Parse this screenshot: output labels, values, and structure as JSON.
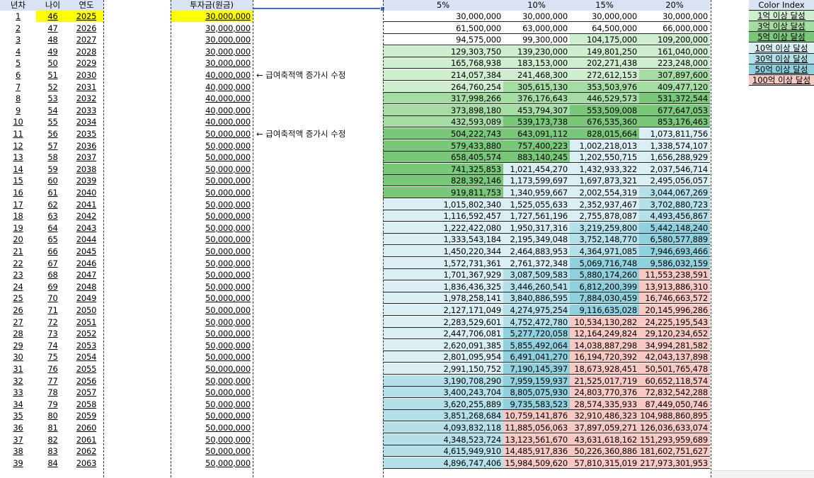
{
  "headers": {
    "year_no": "년차",
    "age": "나이",
    "year": "연도",
    "invest": "투자금(원금)",
    "r5": "5%",
    "r10": "10%",
    "r15": "15%",
    "r20": "20%"
  },
  "notes": [
    {
      "row": 6,
      "text": "← 급여축적액 증가시 수정"
    },
    {
      "row": 11,
      "text": "← 급여축적액 증가시 수정"
    }
  ],
  "legend": {
    "title": "Color Index",
    "items": [
      {
        "label": "1억 이상 달성",
        "color": "#cfeecf"
      },
      {
        "label": "3억 이상 달성",
        "color": "#a4dca4"
      },
      {
        "label": "5억 이상 달성",
        "color": "#79c779"
      },
      {
        "label": "10억 이상 달성",
        "color": "#daeff3"
      },
      {
        "label": "30억 이상 달성",
        "color": "#b3e0e9"
      },
      {
        "label": "50억 이상 달성",
        "color": "#8fd0de"
      },
      {
        "label": "100억 이상 달성",
        "color": "#f7c9c2"
      }
    ]
  },
  "highlight_color": "#ffff00",
  "rows": [
    {
      "n": "1",
      "age": "46",
      "year": "2025",
      "invest": "30,000,000",
      "v5": "30,000,000",
      "v10": "30,000,000",
      "v15": "30,000,000",
      "v20": "30,000,000",
      "c5": "",
      "c10": "",
      "c15": "",
      "c20": ""
    },
    {
      "n": "2",
      "age": "47",
      "year": "2026",
      "invest": "30,000,000",
      "v5": "61,500,000",
      "v10": "63,000,000",
      "v15": "64,500,000",
      "v20": "66,000,000",
      "c5": "",
      "c10": "",
      "c15": "",
      "c20": ""
    },
    {
      "n": "3",
      "age": "48",
      "year": "2027",
      "invest": "30,000,000",
      "v5": "94,575,000",
      "v10": "99,300,000",
      "v15": "104,175,000",
      "v20": "109,200,000",
      "c5": "",
      "c10": "",
      "c15": "#cfeecf",
      "c20": "#cfeecf"
    },
    {
      "n": "4",
      "age": "49",
      "year": "2028",
      "invest": "30,000,000",
      "v5": "129,303,750",
      "v10": "139,230,000",
      "v15": "149,801,250",
      "v20": "161,040,000",
      "c5": "#cfeecf",
      "c10": "#cfeecf",
      "c15": "#cfeecf",
      "c20": "#cfeecf"
    },
    {
      "n": "5",
      "age": "50",
      "year": "2029",
      "invest": "30,000,000",
      "v5": "165,768,938",
      "v10": "183,153,000",
      "v15": "202,271,438",
      "v20": "223,248,000",
      "c5": "#cfeecf",
      "c10": "#cfeecf",
      "c15": "#cfeecf",
      "c20": "#cfeecf"
    },
    {
      "n": "6",
      "age": "51",
      "year": "2030",
      "invest": "40,000,000",
      "v5": "214,057,384",
      "v10": "241,468,300",
      "v15": "272,612,153",
      "v20": "307,897,600",
      "c5": "#cfeecf",
      "c10": "#cfeecf",
      "c15": "#cfeecf",
      "c20": "#a4dca4"
    },
    {
      "n": "7",
      "age": "52",
      "year": "2031",
      "invest": "40,000,000",
      "v5": "264,760,254",
      "v10": "305,615,130",
      "v15": "353,503,976",
      "v20": "409,477,120",
      "c5": "#cfeecf",
      "c10": "#a4dca4",
      "c15": "#a4dca4",
      "c20": "#a4dca4"
    },
    {
      "n": "8",
      "age": "53",
      "year": "2032",
      "invest": "40,000,000",
      "v5": "317,998,266",
      "v10": "376,176,643",
      "v15": "446,529,573",
      "v20": "531,372,544",
      "c5": "#a4dca4",
      "c10": "#a4dca4",
      "c15": "#a4dca4",
      "c20": "#79c779"
    },
    {
      "n": "9",
      "age": "54",
      "year": "2033",
      "invest": "40,000,000",
      "v5": "373,898,180",
      "v10": "453,794,307",
      "v15": "553,509,008",
      "v20": "677,647,053",
      "c5": "#a4dca4",
      "c10": "#a4dca4",
      "c15": "#79c779",
      "c20": "#79c779"
    },
    {
      "n": "10",
      "age": "55",
      "year": "2034",
      "invest": "40,000,000",
      "v5": "432,593,089",
      "v10": "539,173,738",
      "v15": "676,535,360",
      "v20": "853,176,463",
      "c5": "#a4dca4",
      "c10": "#79c779",
      "c15": "#79c779",
      "c20": "#79c779"
    },
    {
      "n": "11",
      "age": "56",
      "year": "2035",
      "invest": "50,000,000",
      "v5": "504,222,743",
      "v10": "643,091,112",
      "v15": "828,015,664",
      "v20": "1,073,811,756",
      "c5": "#79c779",
      "c10": "#79c779",
      "c15": "#79c779",
      "c20": "#daeff3"
    },
    {
      "n": "12",
      "age": "57",
      "year": "2036",
      "invest": "50,000,000",
      "v5": "579,433,880",
      "v10": "757,400,223",
      "v15": "1,002,218,013",
      "v20": "1,338,574,107",
      "c5": "#79c779",
      "c10": "#79c779",
      "c15": "#daeff3",
      "c20": "#daeff3"
    },
    {
      "n": "13",
      "age": "58",
      "year": "2037",
      "invest": "50,000,000",
      "v5": "658,405,574",
      "v10": "883,140,245",
      "v15": "1,202,550,715",
      "v20": "1,656,288,929",
      "c5": "#79c779",
      "c10": "#79c779",
      "c15": "#daeff3",
      "c20": "#daeff3"
    },
    {
      "n": "14",
      "age": "59",
      "year": "2038",
      "invest": "50,000,000",
      "v5": "741,325,853",
      "v10": "1,021,454,270",
      "v15": "1,432,933,322",
      "v20": "2,037,546,714",
      "c5": "#79c779",
      "c10": "#daeff3",
      "c15": "#daeff3",
      "c20": "#daeff3"
    },
    {
      "n": "15",
      "age": "60",
      "year": "2039",
      "invest": "50,000,000",
      "v5": "828,392,146",
      "v10": "1,173,599,697",
      "v15": "1,697,873,321",
      "v20": "2,495,056,057",
      "c5": "#79c779",
      "c10": "#daeff3",
      "c15": "#daeff3",
      "c20": "#daeff3"
    },
    {
      "n": "16",
      "age": "61",
      "year": "2040",
      "invest": "50,000,000",
      "v5": "919,811,753",
      "v10": "1,340,959,667",
      "v15": "2,002,554,319",
      "v20": "3,044,067,269",
      "c5": "#79c779",
      "c10": "#daeff3",
      "c15": "#daeff3",
      "c20": "#b3e0e9"
    },
    {
      "n": "17",
      "age": "62",
      "year": "2041",
      "invest": "50,000,000",
      "v5": "1,015,802,340",
      "v10": "1,525,055,633",
      "v15": "2,352,937,467",
      "v20": "3,702,880,723",
      "c5": "#daeff3",
      "c10": "#daeff3",
      "c15": "#daeff3",
      "c20": "#b3e0e9"
    },
    {
      "n": "18",
      "age": "63",
      "year": "2042",
      "invest": "50,000,000",
      "v5": "1,116,592,457",
      "v10": "1,727,561,196",
      "v15": "2,755,878,087",
      "v20": "4,493,456,867",
      "c5": "#daeff3",
      "c10": "#daeff3",
      "c15": "#daeff3",
      "c20": "#b3e0e9"
    },
    {
      "n": "19",
      "age": "64",
      "year": "2043",
      "invest": "50,000,000",
      "v5": "1,222,422,080",
      "v10": "1,950,317,316",
      "v15": "3,219,259,800",
      "v20": "5,442,148,240",
      "c5": "#daeff3",
      "c10": "#daeff3",
      "c15": "#b3e0e9",
      "c20": "#8fd0de"
    },
    {
      "n": "20",
      "age": "65",
      "year": "2044",
      "invest": "50,000,000",
      "v5": "1,333,543,184",
      "v10": "2,195,349,048",
      "v15": "3,752,148,770",
      "v20": "6,580,577,889",
      "c5": "#daeff3",
      "c10": "#daeff3",
      "c15": "#b3e0e9",
      "c20": "#8fd0de"
    },
    {
      "n": "21",
      "age": "66",
      "year": "2045",
      "invest": "50,000,000",
      "v5": "1,450,220,344",
      "v10": "2,464,883,953",
      "v15": "4,364,971,085",
      "v20": "7,946,693,466",
      "c5": "#daeff3",
      "c10": "#daeff3",
      "c15": "#b3e0e9",
      "c20": "#8fd0de"
    },
    {
      "n": "22",
      "age": "67",
      "year": "2046",
      "invest": "50,000,000",
      "v5": "1,572,731,361",
      "v10": "2,761,372,348",
      "v15": "5,069,716,748",
      "v20": "9,586,032,159",
      "c5": "#daeff3",
      "c10": "#daeff3",
      "c15": "#8fd0de",
      "c20": "#8fd0de"
    },
    {
      "n": "23",
      "age": "68",
      "year": "2047",
      "invest": "50,000,000",
      "v5": "1,701,367,929",
      "v10": "3,087,509,583",
      "v15": "5,880,174,260",
      "v20": "11,553,238,591",
      "c5": "#daeff3",
      "c10": "#b3e0e9",
      "c15": "#8fd0de",
      "c20": "#f7c9c2"
    },
    {
      "n": "24",
      "age": "69",
      "year": "2048",
      "invest": "50,000,000",
      "v5": "1,836,436,325",
      "v10": "3,446,260,541",
      "v15": "6,812,200,399",
      "v20": "13,913,886,310",
      "c5": "#daeff3",
      "c10": "#b3e0e9",
      "c15": "#8fd0de",
      "c20": "#f7c9c2"
    },
    {
      "n": "25",
      "age": "70",
      "year": "2049",
      "invest": "50,000,000",
      "v5": "1,978,258,141",
      "v10": "3,840,886,595",
      "v15": "7,884,030,459",
      "v20": "16,746,663,572",
      "c5": "#daeff3",
      "c10": "#b3e0e9",
      "c15": "#8fd0de",
      "c20": "#f7c9c2"
    },
    {
      "n": "26",
      "age": "71",
      "year": "2050",
      "invest": "50,000,000",
      "v5": "2,127,171,049",
      "v10": "4,274,975,254",
      "v15": "9,116,635,028",
      "v20": "20,145,996,286",
      "c5": "#daeff3",
      "c10": "#b3e0e9",
      "c15": "#8fd0de",
      "c20": "#f7c9c2"
    },
    {
      "n": "27",
      "age": "72",
      "year": "2051",
      "invest": "50,000,000",
      "v5": "2,283,529,601",
      "v10": "4,752,472,780",
      "v15": "10,534,130,282",
      "v20": "24,225,195,543",
      "c5": "#daeff3",
      "c10": "#b3e0e9",
      "c15": "#f7c9c2",
      "c20": "#f7c9c2"
    },
    {
      "n": "28",
      "age": "73",
      "year": "2052",
      "invest": "50,000,000",
      "v5": "2,447,706,081",
      "v10": "5,277,720,058",
      "v15": "12,164,249,824",
      "v20": "29,120,234,652",
      "c5": "#daeff3",
      "c10": "#8fd0de",
      "c15": "#f7c9c2",
      "c20": "#f7c9c2"
    },
    {
      "n": "29",
      "age": "74",
      "year": "2053",
      "invest": "50,000,000",
      "v5": "2,620,091,385",
      "v10": "5,855,492,064",
      "v15": "14,038,887,298",
      "v20": "34,994,281,582",
      "c5": "#daeff3",
      "c10": "#8fd0de",
      "c15": "#f7c9c2",
      "c20": "#f7c9c2"
    },
    {
      "n": "30",
      "age": "75",
      "year": "2054",
      "invest": "50,000,000",
      "v5": "2,801,095,954",
      "v10": "6,491,041,270",
      "v15": "16,194,720,392",
      "v20": "42,043,137,898",
      "c5": "#daeff3",
      "c10": "#8fd0de",
      "c15": "#f7c9c2",
      "c20": "#f7c9c2"
    },
    {
      "n": "31",
      "age": "76",
      "year": "2055",
      "invest": "50,000,000",
      "v5": "2,991,150,752",
      "v10": "7,190,145,397",
      "v15": "18,673,928,451",
      "v20": "50,501,765,478",
      "c5": "#daeff3",
      "c10": "#8fd0de",
      "c15": "#f7c9c2",
      "c20": "#f7c9c2"
    },
    {
      "n": "32",
      "age": "77",
      "year": "2056",
      "invest": "50,000,000",
      "v5": "3,190,708,290",
      "v10": "7,959,159,937",
      "v15": "21,525,017,719",
      "v20": "60,652,118,574",
      "c5": "#b3e0e9",
      "c10": "#8fd0de",
      "c15": "#f7c9c2",
      "c20": "#f7c9c2"
    },
    {
      "n": "33",
      "age": "78",
      "year": "2057",
      "invest": "50,000,000",
      "v5": "3,400,243,704",
      "v10": "8,805,075,930",
      "v15": "24,803,770,376",
      "v20": "72,832,542,288",
      "c5": "#b3e0e9",
      "c10": "#8fd0de",
      "c15": "#f7c9c2",
      "c20": "#f7c9c2"
    },
    {
      "n": "34",
      "age": "79",
      "year": "2058",
      "invest": "50,000,000",
      "v5": "3,620,255,889",
      "v10": "9,735,583,523",
      "v15": "28,574,335,933",
      "v20": "87,449,050,746",
      "c5": "#b3e0e9",
      "c10": "#8fd0de",
      "c15": "#f7c9c2",
      "c20": "#f7c9c2"
    },
    {
      "n": "35",
      "age": "80",
      "year": "2059",
      "invest": "50,000,000",
      "v5": "3,851,268,684",
      "v10": "10,759,141,876",
      "v15": "32,910,486,323",
      "v20": "104,988,860,895",
      "c5": "#b3e0e9",
      "c10": "#f7c9c2",
      "c15": "#f7c9c2",
      "c20": "#f7c9c2"
    },
    {
      "n": "36",
      "age": "81",
      "year": "2060",
      "invest": "50,000,000",
      "v5": "4,093,832,118",
      "v10": "11,885,056,063",
      "v15": "37,897,059,271",
      "v20": "126,036,633,074",
      "c5": "#b3e0e9",
      "c10": "#f7c9c2",
      "c15": "#f7c9c2",
      "c20": "#f7c9c2"
    },
    {
      "n": "37",
      "age": "82",
      "year": "2061",
      "invest": "50,000,000",
      "v5": "4,348,523,724",
      "v10": "13,123,561,670",
      "v15": "43,631,618,162",
      "v20": "151,293,959,689",
      "c5": "#b3e0e9",
      "c10": "#f7c9c2",
      "c15": "#f7c9c2",
      "c20": "#f7c9c2"
    },
    {
      "n": "38",
      "age": "83",
      "year": "2062",
      "invest": "50,000,000",
      "v5": "4,615,949,910",
      "v10": "14,485,917,836",
      "v15": "50,226,360,886",
      "v20": "181,602,751,627",
      "c5": "#b3e0e9",
      "c10": "#f7c9c2",
      "c15": "#f7c9c2",
      "c20": "#f7c9c2"
    },
    {
      "n": "39",
      "age": "84",
      "year": "2063",
      "invest": "50,000,000",
      "v5": "4,896,747,406",
      "v10": "15,984,509,620",
      "v15": "57,810,315,019",
      "v20": "217,973,301,953",
      "c5": "#b3e0e9",
      "c10": "#f7c9c2",
      "c15": "#f7c9c2",
      "c20": "#f7c9c2"
    }
  ]
}
